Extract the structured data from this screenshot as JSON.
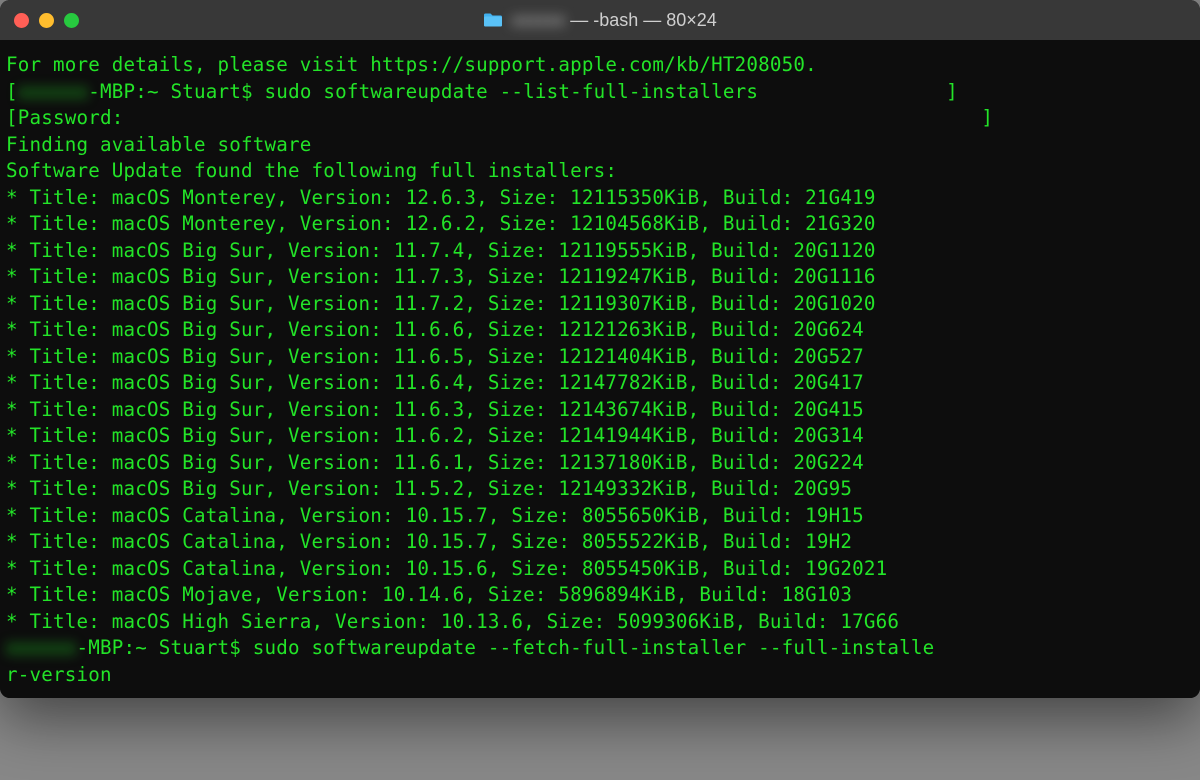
{
  "window": {
    "title_suffix": " — -bash — 80×24",
    "title_redacted": "xxxxxx"
  },
  "term": {
    "line_info": "For more details, please visit https://support.apple.com/kb/HT208050.",
    "prompt_prefix": "[",
    "host_redacted": "xxxxxx",
    "host_suffix": "-MBP:~ Stuart$ ",
    "cmd1": "sudo softwareupdate --list-full-installers",
    "cmd1_tail": "                ]",
    "password_label": "[Password:",
    "password_tail": "                                                                         ]",
    "finding": "Finding available software",
    "found": "Software Update found the following full installers:",
    "installers": [
      {
        "title": "macOS Monterey",
        "version": "12.6.3",
        "size": "12115350KiB",
        "build": "21G419"
      },
      {
        "title": "macOS Monterey",
        "version": "12.6.2",
        "size": "12104568KiB",
        "build": "21G320"
      },
      {
        "title": "macOS Big Sur",
        "version": "11.7.4",
        "size": "12119555KiB",
        "build": "20G1120"
      },
      {
        "title": "macOS Big Sur",
        "version": "11.7.3",
        "size": "12119247KiB",
        "build": "20G1116"
      },
      {
        "title": "macOS Big Sur",
        "version": "11.7.2",
        "size": "12119307KiB",
        "build": "20G1020"
      },
      {
        "title": "macOS Big Sur",
        "version": "11.6.6",
        "size": "12121263KiB",
        "build": "20G624"
      },
      {
        "title": "macOS Big Sur",
        "version": "11.6.5",
        "size": "12121404KiB",
        "build": "20G527"
      },
      {
        "title": "macOS Big Sur",
        "version": "11.6.4",
        "size": "12147782KiB",
        "build": "20G417"
      },
      {
        "title": "macOS Big Sur",
        "version": "11.6.3",
        "size": "12143674KiB",
        "build": "20G415"
      },
      {
        "title": "macOS Big Sur",
        "version": "11.6.2",
        "size": "12141944KiB",
        "build": "20G314"
      },
      {
        "title": "macOS Big Sur",
        "version": "11.6.1",
        "size": "12137180KiB",
        "build": "20G224"
      },
      {
        "title": "macOS Big Sur",
        "version": "11.5.2",
        "size": "12149332KiB",
        "build": "20G95"
      },
      {
        "title": "macOS Catalina",
        "version": "10.15.7",
        "size": "8055650KiB",
        "build": "19H15"
      },
      {
        "title": "macOS Catalina",
        "version": "10.15.7",
        "size": "8055522KiB",
        "build": "19H2"
      },
      {
        "title": "macOS Catalina",
        "version": "10.15.6",
        "size": "8055450KiB",
        "build": "19G2021"
      },
      {
        "title": "macOS Mojave",
        "version": "10.14.6",
        "size": "5896894KiB",
        "build": "18G103"
      },
      {
        "title": "macOS High Sierra",
        "version": "10.13.6",
        "size": "5099306KiB",
        "build": "17G66"
      }
    ],
    "cmd2_part1": "sudo softwareupdate --fetch-full-installer --full-installe",
    "cmd2_part2": "r-version "
  }
}
